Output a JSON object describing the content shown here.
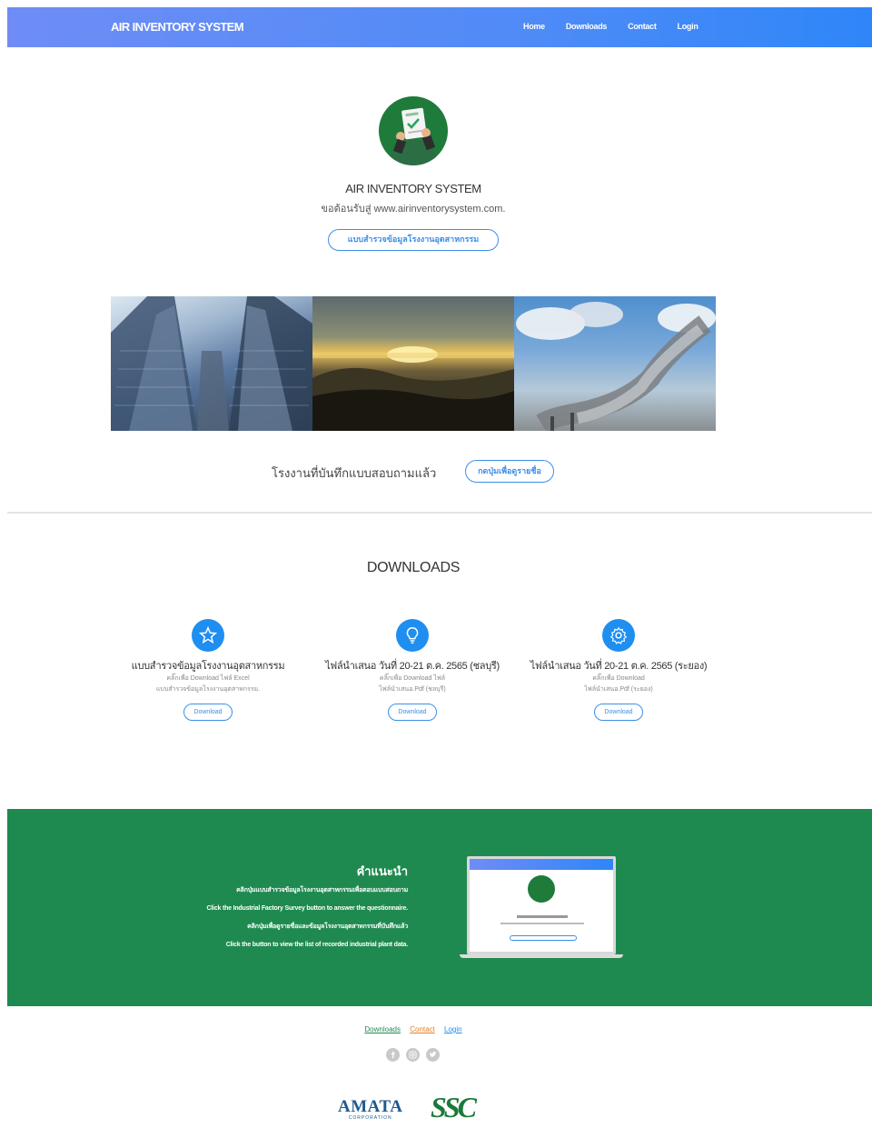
{
  "navbar": {
    "brand": "AIR INVENTORY SYSTEM",
    "links": [
      "Home",
      "Downloads",
      "Contact",
      "Login"
    ]
  },
  "hero": {
    "title": "AIR INVENTORY SYSTEM",
    "subtitle": "ขอต้อนรับสู่ www.airinventorysystem.com.",
    "survey_button": "แบบสำรวจข้อมูลโรงงานอุตสาหกรรม"
  },
  "recorded": {
    "label": "โรงงานที่บันทึกแบบสอบถามแล้ว",
    "button": "กดปุ่มเพื่อดูรายชื่อ"
  },
  "downloads": {
    "title": "DOWNLOADS",
    "cards": [
      {
        "icon": "star-icon",
        "name": "แบบสำรวจข้อมูลโรงงานอุตสาหกรรม",
        "desc1": "คลิ๊กเพื่อ Download ไฟล์ Excel",
        "desc2": "แบบสำรวจข้อมูลโรงงานอุตสาหกรรม.",
        "button": "Download"
      },
      {
        "icon": "lightbulb-icon",
        "name": "ไฟล์นำเสนอ วันที่ 20-21 ต.ค. 2565 (ชลบุรี)",
        "desc1": "คลิ๊กเพื่อ Download ไฟล์",
        "desc2": "ไฟล์นำเสนอ.Pdf (ชลบุรี)",
        "button": "Download"
      },
      {
        "icon": "gear-icon",
        "name": "ไฟล์นำเสนอ วันที่ 20-21 ต.ค. 2565 (ระยอง)",
        "desc1": "คลิ๊กเพื่อ Download",
        "desc2": "ไฟล์นำเสนอ.Pdf (ระยอง)",
        "button": "Download"
      }
    ]
  },
  "instructions": {
    "heading": "คำแนะนำ",
    "lines": [
      "คลิกปุ่มแบบสำรวจข้อมูลโรงงานอุตสาหกรรมเพื่อตอบแบบสอบถาม",
      "Click the Industrial Factory Survey button to answer the questionnaire.",
      "คลิกปุ่มเพื่อดูรายชื่อและข้อมูลโรงงานอุตสาหกรรมที่บันทึกแล้ว",
      "Click the button to view the list of recorded industrial plant data."
    ]
  },
  "footer": {
    "links": [
      "Downloads",
      "Contact",
      "Login"
    ],
    "socials": [
      "facebook-icon",
      "instagram-icon",
      "twitter-icon"
    ],
    "amata": "AMATA",
    "amata_sub": "CORPORATION",
    "ssc": "SSC"
  },
  "colors": {
    "nav_gradient_start": "#6f8cf5",
    "nav_gradient_end": "#2f86f8",
    "accent_blue": "#1f8ef1",
    "green_section": "#1f8a4f"
  }
}
